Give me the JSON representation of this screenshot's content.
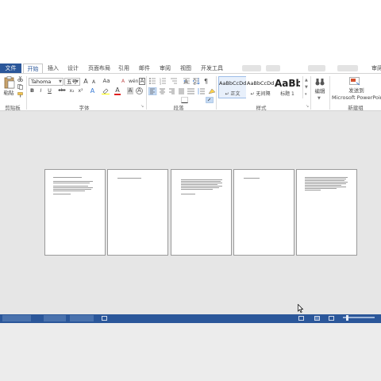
{
  "tabs": [
    "文件",
    "开始",
    "插入",
    "设计",
    "页面布局",
    "引用",
    "邮件",
    "审阅",
    "视图",
    "开发工具"
  ],
  "tabs_right_label": "审阅",
  "ribbon": {
    "clipboard": {
      "paste": "粘贴",
      "label": "剪贴板"
    },
    "font": {
      "name": "Tahoma",
      "size": "五号",
      "label": "字体",
      "grow": "A",
      "shrink": "A",
      "case": "Aa",
      "bold": "B",
      "italic": "I",
      "underline": "U",
      "strike": "abc",
      "subscript": "x₂",
      "superscript": "x²",
      "font_color": "A",
      "char_shade": "A",
      "char_border": "A",
      "text_effect": "A",
      "phonetic": "wén"
    },
    "paragraph": {
      "label": "段落"
    },
    "styles": {
      "label": "样式",
      "items": [
        {
          "sample": "AaBbCcDd",
          "name": "↵ 正文"
        },
        {
          "sample": "AaBbCcDd",
          "name": "↵ 无间隔"
        },
        {
          "sample": "AaBb",
          "name": "标题 1"
        }
      ]
    },
    "editing": {
      "label": "编辑"
    },
    "new_group": {
      "send_line1": "发送到",
      "send_line2": "Microsoft PowerPoint",
      "label": "新建组"
    }
  },
  "status_colors": {
    "ribbon_blue": "#2b579a",
    "workspace": "#e6e6e6"
  },
  "pages_count": 5
}
